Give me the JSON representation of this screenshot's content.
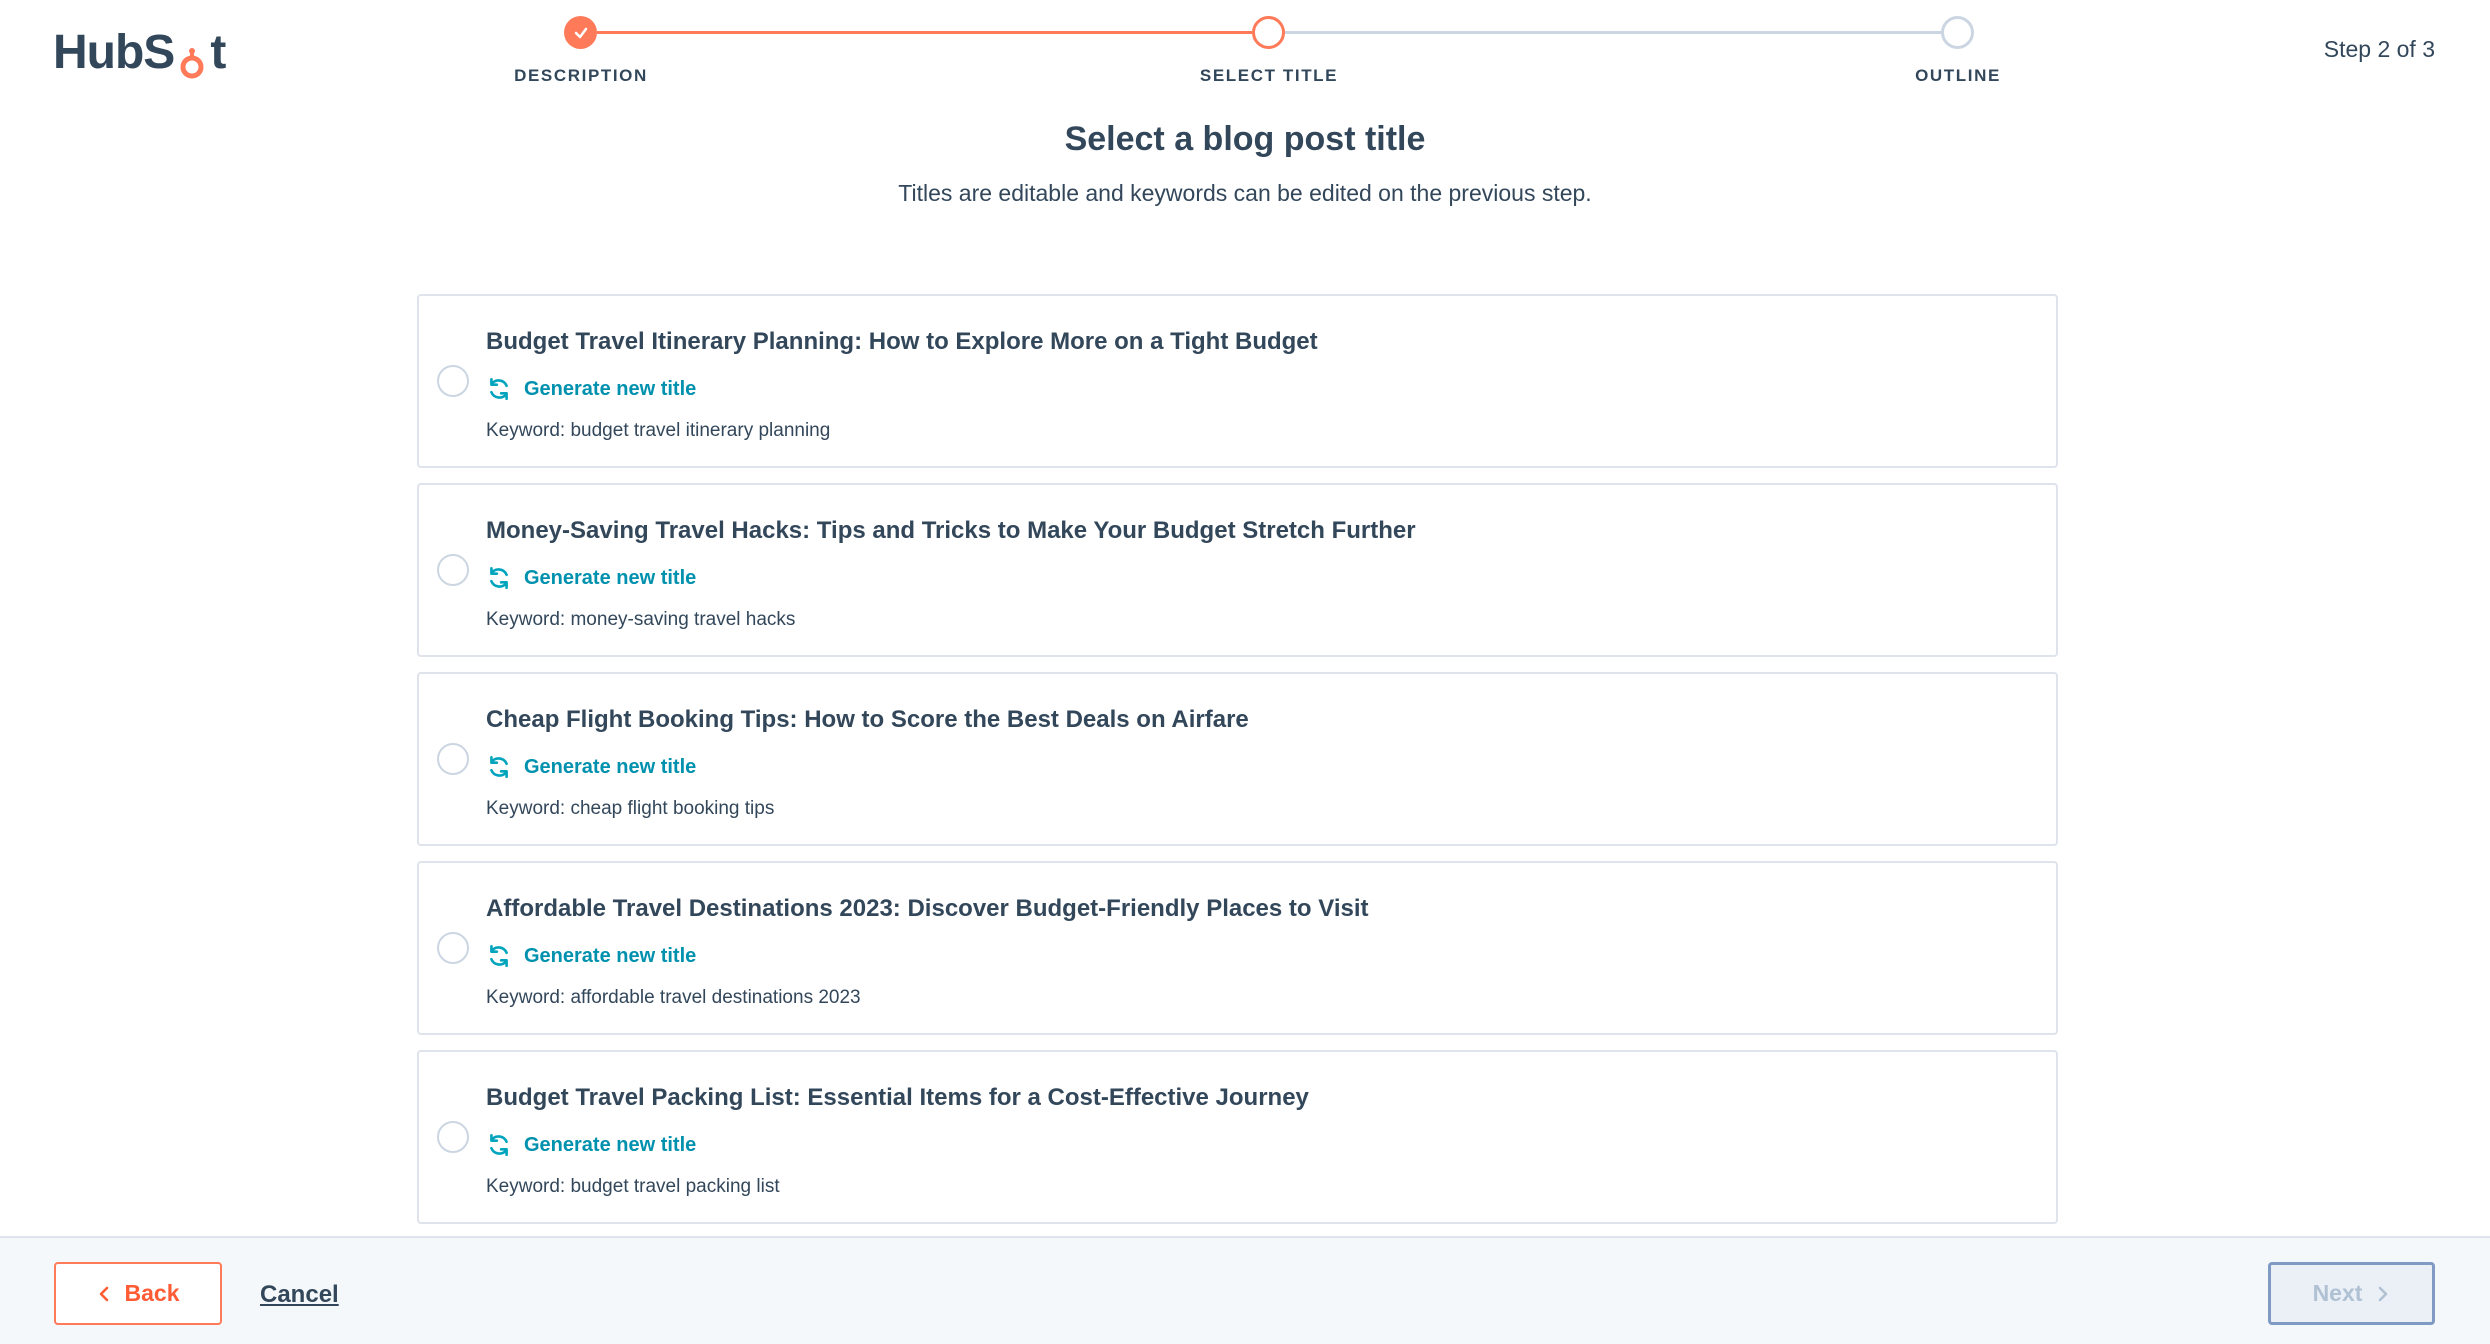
{
  "brand": {
    "logo_text_pre": "HubS",
    "logo_text_post": "t",
    "accent": "#ff7a59"
  },
  "stepper": {
    "steps": [
      {
        "label": "DESCRIPTION",
        "state": "complete"
      },
      {
        "label": "SELECT TITLE",
        "state": "current"
      },
      {
        "label": "OUTLINE",
        "state": "upcoming"
      }
    ],
    "count_text": "Step 2 of 3"
  },
  "header": {
    "title": "Select a blog post title",
    "subtitle": "Titles are editable and keywords can be edited on the previous step."
  },
  "options": [
    {
      "title": "Budget Travel Itinerary Planning: How to Explore More on a Tight Budget",
      "action": "Generate new title",
      "keyword": "Keyword: budget travel itinerary planning"
    },
    {
      "title": "Money-Saving Travel Hacks: Tips and Tricks to Make Your Budget Stretch Further",
      "action": "Generate new title",
      "keyword": "Keyword: money-saving travel hacks"
    },
    {
      "title": "Cheap Flight Booking Tips: How to Score the Best Deals on Airfare",
      "action": "Generate new title",
      "keyword": "Keyword: cheap flight booking tips"
    },
    {
      "title": "Affordable Travel Destinations 2023: Discover Budget-Friendly Places to Visit",
      "action": "Generate new title",
      "keyword": "Keyword: affordable travel destinations 2023"
    },
    {
      "title": "Budget Travel Packing List: Essential Items for a Cost-Effective Journey",
      "action": "Generate new title",
      "keyword": "Keyword: budget travel packing list"
    }
  ],
  "footer": {
    "back_label": "Back",
    "cancel_label": "Cancel",
    "next_label": "Next"
  }
}
